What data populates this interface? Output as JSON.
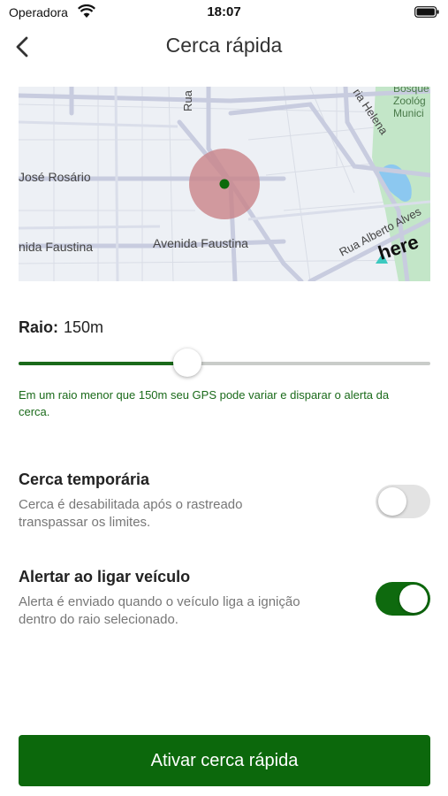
{
  "status_bar": {
    "carrier": "Operadora",
    "time": "18:07"
  },
  "nav": {
    "title": "Cerca rápida"
  },
  "map": {
    "labels": {
      "rua_top": "Rua",
      "jose_rosario": "José Rosário",
      "avenida_faustina_left": "nida Faustina",
      "avenida_faustina": "Avenida Faustina",
      "rua_alberto_alves": "Rua Alberto Alves",
      "ria_helena": "ria Helena",
      "bosque_1": "Bosque",
      "bosque_2": "Zoológ",
      "bosque_3": "Munici",
      "here_logo": "here"
    },
    "colors": {
      "water": "#8cc8f0",
      "park": "#c3e6c8",
      "geofence": "#c98388",
      "center": "#0b6a0b"
    }
  },
  "radius": {
    "label": "Raio:",
    "value": "150m",
    "level": 0.41
  },
  "hint": "Em um raio menor que 150m seu GPS pode variar e disparar o alerta da cerca.",
  "settings": {
    "temporary": {
      "title": "Cerca temporária",
      "description": "Cerca é desabilitada após o rastreado transpassar os limites.",
      "enabled": false
    },
    "ignition": {
      "title": "Alertar ao ligar veículo",
      "description": "Alerta é enviado quando o veículo liga a ignição dentro do raio selecionado.",
      "enabled": true
    }
  },
  "cta": {
    "label": "Ativar cerca rápida"
  },
  "theme": {
    "accent": "#0c680c"
  }
}
